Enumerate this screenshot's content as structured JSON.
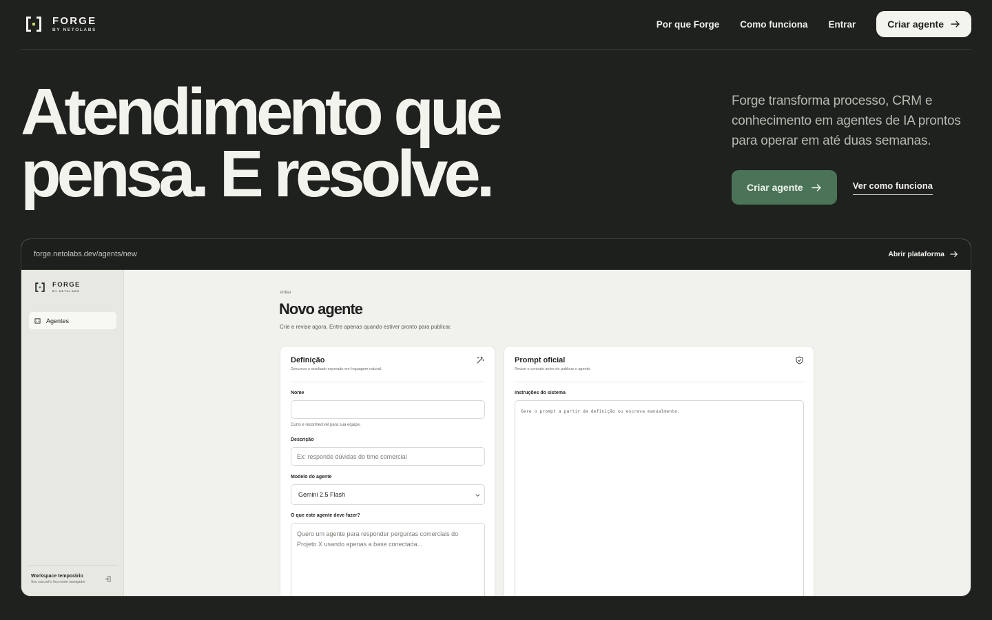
{
  "nav": {
    "brand": "FORGE",
    "brand_sub": "BY NETOLABS",
    "links": [
      "Por que Forge",
      "Como funciona",
      "Entrar"
    ],
    "cta": "Criar agente"
  },
  "hero": {
    "title_line1": "Atendimento que",
    "title_line2": "pensa. E resolve.",
    "description": "Forge transforma processo, CRM e conhecimento em agentes de IA prontos para operar em até duas semanas.",
    "primary_cta": "Criar agente",
    "secondary_cta": "Ver como funciona"
  },
  "browser": {
    "url": "forge.netolabs.dev/agents/new",
    "open_label": "Abrir plataforma"
  },
  "app": {
    "brand": "FORGE",
    "brand_sub": "BY NETOLABS",
    "sidebar_item": "Agentes",
    "workspace_title": "Workspace temporário",
    "workspace_sub": "Seu rascunho fica neste navegador",
    "back": "Voltar",
    "page_title": "Novo agente",
    "page_sub": "Crie e revise agora. Entre apenas quando estiver pronto para publicar.",
    "definition": {
      "title": "Definição",
      "desc": "Descreva o resultado esperado em linguagem natural.",
      "name_label": "Nome",
      "name_value": "",
      "name_hint": "Curto e reconhecível para sua equipe.",
      "description_label": "Descrição",
      "description_placeholder": "Ex: responde dúvidas do time comercial",
      "model_label": "Modelo do agente",
      "model_value": "Gemini 2.5 Flash",
      "task_label": "O que este agente deve fazer?",
      "task_placeholder": "Quero um agente para responder perguntas comerciais do Projeto X usando apenas a base conectada..."
    },
    "prompt": {
      "title": "Prompt oficial",
      "desc": "Revise o contrato antes de publicar o agente.",
      "instructions_label": "Instruções do sistema",
      "instructions_placeholder": "Gere o prompt a partir da definição ou escreva manualmente."
    }
  },
  "colors": {
    "background": "#1f211e",
    "accent_green": "#4a7358",
    "logo_accent": "#c8d96a"
  }
}
